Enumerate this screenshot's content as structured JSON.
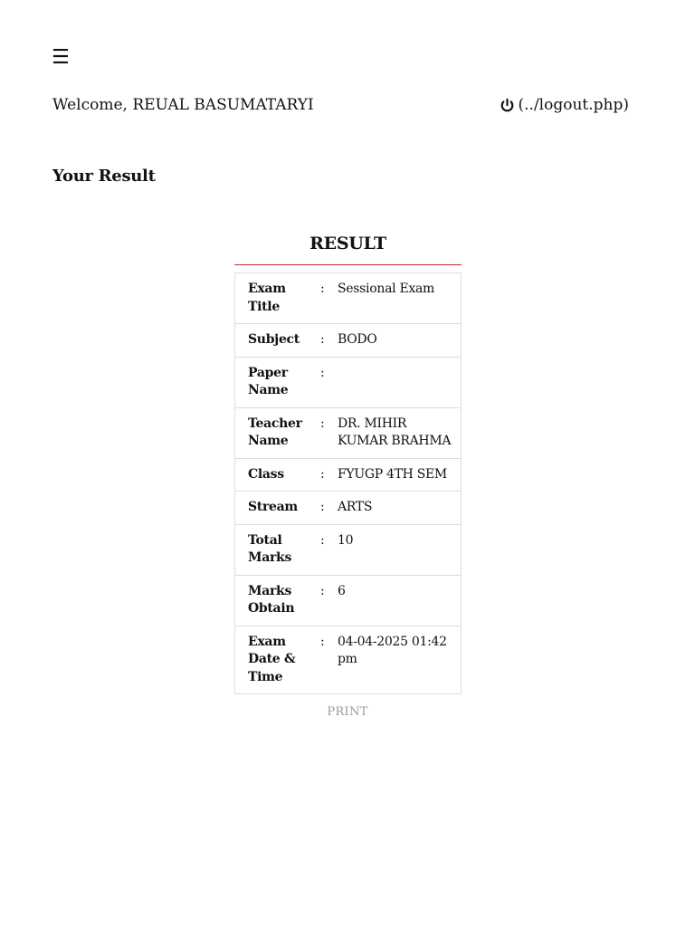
{
  "header": {
    "menu_icon": "hamburger-menu-icon",
    "menu_glyph": "☰",
    "welcome_text": "Welcome, REUAL BASUMATARYI",
    "logout_icon": "power-icon",
    "logout_text": "(../logout.php)"
  },
  "page": {
    "section_title": "Your Result"
  },
  "result": {
    "heading": "RESULT",
    "separator": ":",
    "rows": [
      {
        "label": "Exam Title",
        "value": "Sessional Exam"
      },
      {
        "label": "Subject",
        "value": "BODO"
      },
      {
        "label": "Paper Name",
        "value": ""
      },
      {
        "label": "Teacher Name",
        "value": "DR. MIHIR KUMAR BRAHMA"
      },
      {
        "label": "Class",
        "value": "FYUGP 4TH SEM"
      },
      {
        "label": "Stream",
        "value": "ARTS"
      },
      {
        "label": "Total Marks",
        "value": "10"
      },
      {
        "label": "Marks Obtain",
        "value": "6"
      },
      {
        "label": "Exam Date & Time",
        "value": "04-04-2025 01:42 pm"
      }
    ]
  },
  "actions": {
    "print_label": "PRINT"
  },
  "colors": {
    "accent_red": "#c9302c",
    "border_gray": "#dddddd",
    "muted_text": "#9a9a9a"
  }
}
